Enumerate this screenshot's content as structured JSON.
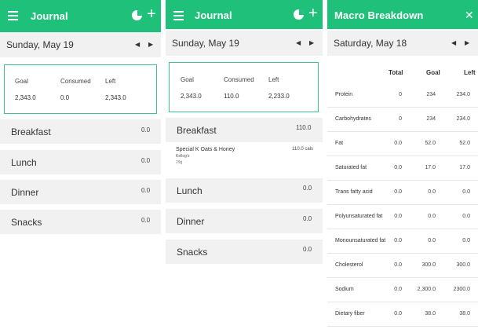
{
  "colors": {
    "accent": "#1fc07a",
    "meal_bg": "#f1f1f1"
  },
  "screen1": {
    "title": "Journal",
    "icons": [
      "menu-icon",
      "pie-chart-icon",
      "add-icon"
    ],
    "date": "Sunday, May 19",
    "summary": {
      "goal_label": "Goal",
      "consumed_label": "Consumed",
      "left_label": "Left",
      "goal": "2,343.0",
      "consumed": "0.0",
      "left": "2,343.0"
    },
    "meals": [
      {
        "name": "Breakfast",
        "cal": "0.0"
      },
      {
        "name": "Lunch",
        "cal": "0.0"
      },
      {
        "name": "Dinner",
        "cal": "0.0"
      },
      {
        "name": "Snacks",
        "cal": "0.0"
      }
    ]
  },
  "screen2": {
    "title": "Journal",
    "date": "Sunday, May 19",
    "summary": {
      "goal_label": "Goal",
      "consumed_label": "Consumed",
      "left_label": "Left",
      "goal": "2,343.0",
      "consumed": "110.0",
      "left": "2,233.0"
    },
    "meals": [
      {
        "name": "Breakfast",
        "cal": "110.0"
      },
      {
        "name": "Lunch",
        "cal": "0.0"
      },
      {
        "name": "Dinner",
        "cal": "0.0"
      },
      {
        "name": "Snacks",
        "cal": "0.0"
      }
    ],
    "food": {
      "name": "Special K Oats & Honey",
      "brand": "Kellog's",
      "serving": "29g",
      "cal": "110.0 cals"
    }
  },
  "screen3": {
    "title": "Macro Breakdown",
    "date": "Saturday, May 18",
    "columns": {
      "total": "Total",
      "goal": "Goal",
      "left": "Left"
    },
    "rows": [
      {
        "name": "Protein",
        "total": "0",
        "goal": "234",
        "left": "234.0"
      },
      {
        "name": "Carbohydrates",
        "total": "0",
        "goal": "234",
        "left": "234.0"
      },
      {
        "name": "Fat",
        "total": "0.0",
        "goal": "52.0",
        "left": "52.0"
      },
      {
        "name": "Saturated fat",
        "total": "0.0",
        "goal": "17.0",
        "left": "17.0"
      },
      {
        "name": "Trans fatty acid",
        "total": "0.0",
        "goal": "0.0",
        "left": "0.0"
      },
      {
        "name": "Polyunsaturated fat",
        "total": "0.0",
        "goal": "0.0",
        "left": "0.0"
      },
      {
        "name": "Monounsaturated fat",
        "total": "0.0",
        "goal": "0.0",
        "left": "0.0"
      },
      {
        "name": "Cholesterol",
        "total": "0.0",
        "goal": "300.0",
        "left": "300.0"
      },
      {
        "name": "Sodium",
        "total": "0.0",
        "goal": "2,300.0",
        "left": "2300.0"
      },
      {
        "name": "Dietary fiber",
        "total": "0.0",
        "goal": "38.0",
        "left": "38.0"
      }
    ]
  }
}
